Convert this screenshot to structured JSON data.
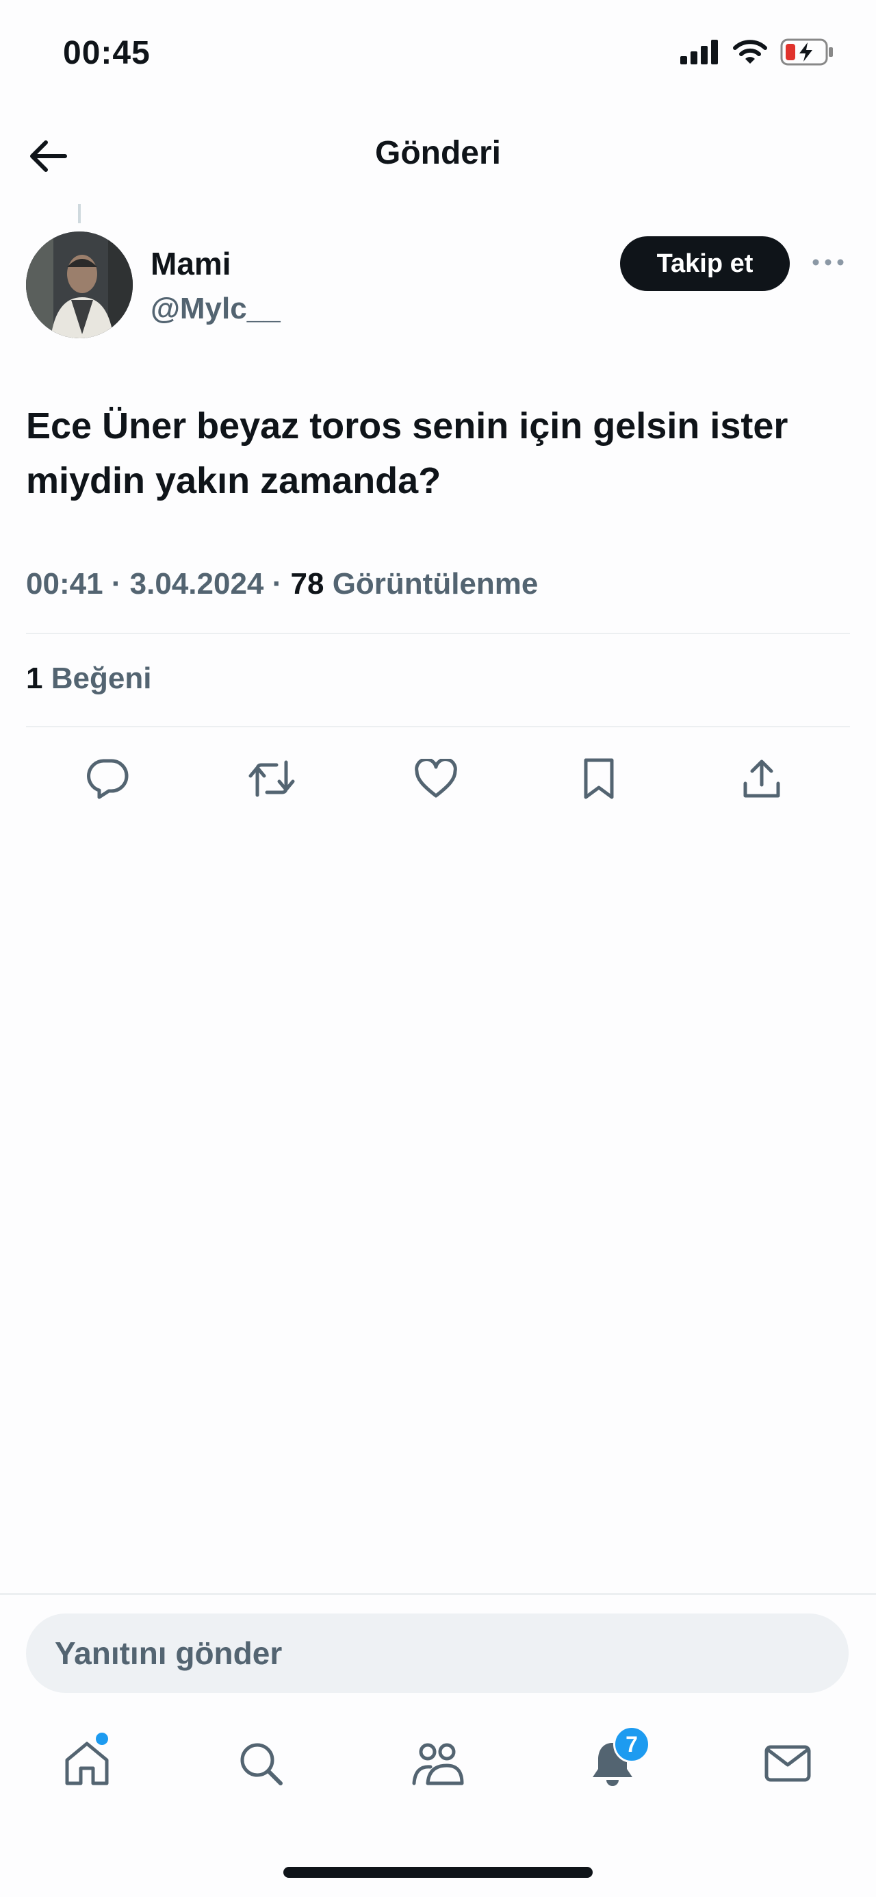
{
  "status_bar": {
    "time": "00:45"
  },
  "header": {
    "title": "Gönderi"
  },
  "author": {
    "name": "Mami",
    "handle": "@Mylc__",
    "follow_label": "Takip et"
  },
  "tweet": {
    "text": "Ece Üner beyaz toros senin için gelsin ister miydin yakın zamanda?",
    "time": "00:41",
    "date": "3.04.2024",
    "views_count": "78",
    "views_label": "Görüntülenme",
    "separator": " · "
  },
  "likes": {
    "count": "1",
    "label": "Beğeni"
  },
  "reply": {
    "placeholder": "Yanıtını gönder"
  },
  "tabbar": {
    "notifications_badge": "7"
  },
  "icons": {
    "back": "arrow-left-icon",
    "more": "more-dots-icon",
    "reply": "comment-icon",
    "retweet": "retweet-icon",
    "like": "heart-icon",
    "bookmark": "bookmark-icon",
    "share": "share-icon",
    "home": "home-icon",
    "search": "search-icon",
    "communities": "communities-icon",
    "notifications": "bell-icon",
    "messages": "mail-icon"
  },
  "colors": {
    "accent": "#1d9bf0",
    "text": "#0f1419",
    "muted": "#536471"
  }
}
